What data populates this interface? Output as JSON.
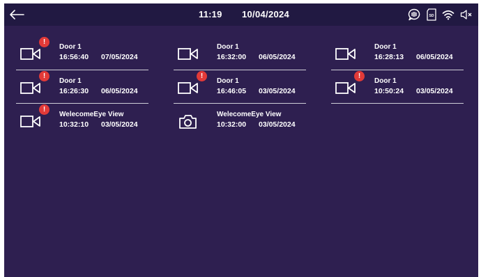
{
  "header": {
    "back_icon": "arrow-left-icon",
    "time": "11:19",
    "date": "10/04/2024",
    "status_icons": [
      "voice-message-icon",
      "sd-card-icon",
      "wifi-icon",
      "speaker-muted-icon"
    ]
  },
  "records": [
    {
      "name": "Door 1",
      "time": "16:56:40",
      "date": "07/05/2024",
      "icon": "video-camera-icon",
      "alert": "!"
    },
    {
      "name": "Door 1",
      "time": "16:32:00",
      "date": "06/05/2024",
      "icon": "video-camera-icon",
      "alert": ""
    },
    {
      "name": "Door 1",
      "time": "16:28:13",
      "date": "06/05/2024",
      "icon": "video-camera-icon",
      "alert": ""
    },
    {
      "name": "Door 1",
      "time": "16:26:30",
      "date": "06/05/2024",
      "icon": "video-camera-icon",
      "alert": "!"
    },
    {
      "name": "Door 1",
      "time": "16:46:05",
      "date": "03/05/2024",
      "icon": "video-camera-icon",
      "alert": "!"
    },
    {
      "name": "Door 1",
      "time": "10:50:24",
      "date": "03/05/2024",
      "icon": "video-camera-icon",
      "alert": "!"
    },
    {
      "name": "WelecomeEye View",
      "time": "10:32:10",
      "date": "03/05/2024",
      "icon": "video-camera-icon",
      "alert": "!"
    },
    {
      "name": "WelecomeEye View",
      "time": "10:32:00",
      "date": "03/05/2024",
      "icon": "photo-camera-icon",
      "alert": ""
    }
  ],
  "colors": {
    "background": "#2e1f50",
    "topbar": "#211942",
    "alert": "#e23a38",
    "text": "#ffffff"
  }
}
